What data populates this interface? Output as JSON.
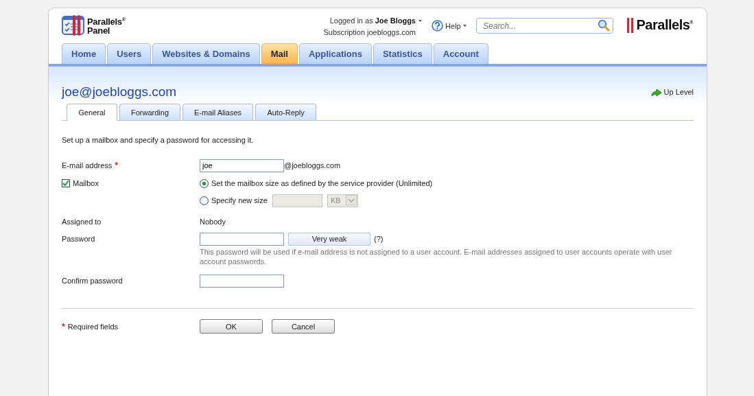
{
  "header": {
    "logo_text": "Parallels$^{®}$",
    "logo_subtext": "Panel",
    "user_prefix": "Logged in as",
    "user_name": "Joe Bloggs",
    "subscription_label": "Subscription",
    "subscription": "joebloggs.com",
    "help": "Help",
    "search": {
      "placeholder": "Search..."
    },
    "brand": "Parallels$^{®}$"
  },
  "nav_tabs": [
    {
      "label": "Home",
      "selected": false
    },
    {
      "label": "Users",
      "selected": false
    },
    {
      "label": "Websites & Domains",
      "selected": false
    },
    {
      "label": "Mail",
      "selected": true
    },
    {
      "label": "Applications",
      "selected": false
    },
    {
      "label": "Statistics",
      "selected": false
    },
    {
      "label": "Account",
      "selected": false
    }
  ],
  "page": {
    "title": "joe@joebloggs.com",
    "up_level": "Up Level"
  },
  "sub_tabs": [
    {
      "label": "General",
      "selected": true
    },
    {
      "label": "Forwarding",
      "selected": false
    },
    {
      "label": "E-mail Aliases",
      "selected": false
    },
    {
      "label": "Auto-Reply",
      "selected": false
    }
  ],
  "intro": "Set up a mailbox and specify a password for accessing it.",
  "form": {
    "email": {
      "label": "E-mail address",
      "required_mark": "*",
      "value": "joe",
      "suffix": "@joebloggs.com"
    },
    "mailbox": {
      "label": "Mailbox",
      "checked": true,
      "options": [
        {
          "label": "Set the mailbox size as defined by the service provider (Unlimited)",
          "selected": true
        },
        {
          "label": "Specify new size",
          "selected": false
        }
      ],
      "size_disabled": true,
      "size_unit": "KB"
    },
    "assigned": {
      "label": "Assigned to",
      "value": "Nobody"
    },
    "password": {
      "label": "Password",
      "strength": "Very weak",
      "help_link": "(?)",
      "hint": "This password will be used if e-mail address is not assigned to a user account. E-mail addresses assigned to user accounts operate with user account passwords."
    },
    "confirm": {
      "label": "Confirm password"
    }
  },
  "footer": {
    "required_mark": "*",
    "required_note": "Required fields",
    "buttons": [
      "OK",
      "Cancel"
    ]
  }
}
